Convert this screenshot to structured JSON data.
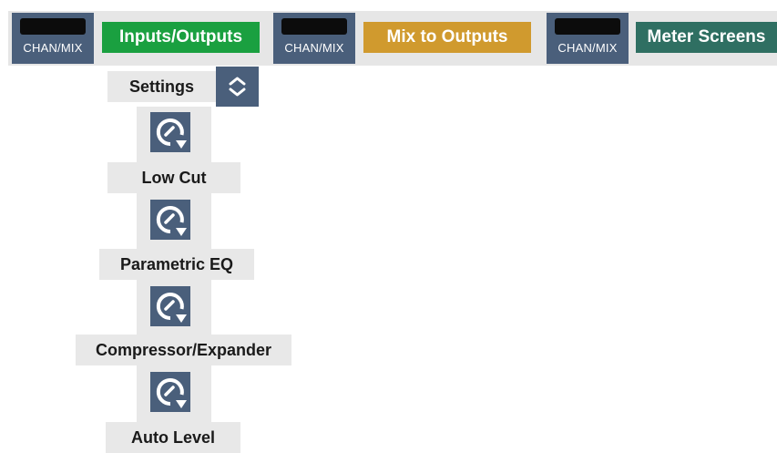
{
  "topbar": {
    "chan_mix_label": "CHAN/MIX",
    "tabs": {
      "inputs_outputs": "Inputs/Outputs",
      "mix_to_outputs": "Mix to Outputs",
      "meter_screens": "Meter Screens"
    }
  },
  "settings": {
    "label": "Settings",
    "stepper_icon": "up-down-chevron-icon"
  },
  "sections": {
    "low_cut": "Low Cut",
    "parametric_eq": "Parametric EQ",
    "compressor_expander": "Compressor/Expander",
    "auto_level": "Auto Level"
  },
  "icons": {
    "knob": "knob-rotate-icon"
  },
  "colors": {
    "chan_button": "#4a5f7b",
    "inputs_outputs": "#1aa040",
    "mix_to_outputs": "#d09a2e",
    "meter_screens": "#2f6f62",
    "panel_bg": "#e8e8e8"
  }
}
